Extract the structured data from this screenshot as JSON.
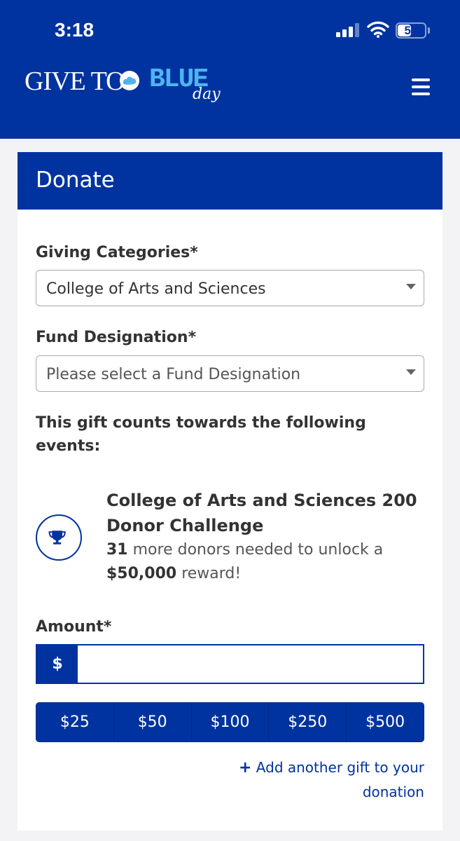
{
  "status_bar": {
    "time": "3:18",
    "battery": "51",
    "battery_level": 0.51
  },
  "header": {
    "logo": {
      "part1": "GIVE TO",
      "part2": "BLUE",
      "part3": "day"
    },
    "menu_icon": "hamburger-icon"
  },
  "card": {
    "title": "Donate",
    "giving_categories": {
      "label": "Giving Categories*",
      "value": "College of Arts and Sciences"
    },
    "fund_designation": {
      "label": "Fund Designation*",
      "placeholder": "Please select a Fund Designation"
    },
    "counts_text": "This gift counts towards the following events:",
    "event": {
      "icon": "trophy-icon",
      "title": "College of Arts and Sciences 200 Donor Challenge",
      "donors_count": "31",
      "desc_middle": "more donors needed to unlock a",
      "reward": "$50,000",
      "desc_end": "reward!"
    },
    "amount": {
      "label": "Amount*",
      "currency": "$",
      "value": ""
    },
    "quick_amounts": [
      "$25",
      "$50",
      "$100",
      "$250",
      "$500"
    ],
    "add_gift": {
      "icon": "plus-icon",
      "text": "Add another gift to your donation"
    }
  },
  "colors": {
    "brand_blue": "#0033a0",
    "light_blue": "#4fb3f0"
  }
}
